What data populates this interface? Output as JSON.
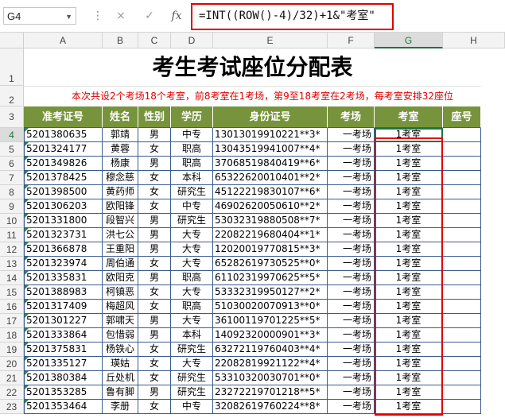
{
  "formula_bar": {
    "name_box": "G4",
    "cancel_icon": "×",
    "enter_icon": "✓",
    "fx_label": "fx",
    "formula": "=INT((ROW()-4)/32)+1&\"考室\""
  },
  "columns": [
    "A",
    "B",
    "C",
    "D",
    "E",
    "F",
    "G",
    "H"
  ],
  "selected_column": "G",
  "selected_row": "4",
  "rows_numbers": [
    "1",
    "2",
    "3",
    "4",
    "5",
    "6",
    "7",
    "8",
    "9",
    "10",
    "11",
    "12",
    "13",
    "14",
    "15",
    "16",
    "17",
    "18",
    "19",
    "20",
    "21",
    "22",
    "23"
  ],
  "sheet": {
    "title": "考生考试座位分配表",
    "subtitle": "本次共设2个考场18个考室，前8考室在1考场，第9至18考室在2考场，每考室安排32座位",
    "headers": [
      "准考证号",
      "姓名",
      "性别",
      "学历",
      "身份证号",
      "考场",
      "考室",
      "座号"
    ],
    "rows": [
      [
        "5201380635",
        "郭靖",
        "男",
        "中专",
        "13013019910221**3*",
        "一考场",
        "1考室",
        ""
      ],
      [
        "5201324177",
        "黄蓉",
        "女",
        "职高",
        "13043519941007**4*",
        "一考场",
        "1考室",
        ""
      ],
      [
        "5201349826",
        "杨康",
        "男",
        "职高",
        "37068519840419**6*",
        "一考场",
        "1考室",
        ""
      ],
      [
        "5201378425",
        "穆念慈",
        "女",
        "本科",
        "65322620010401**2*",
        "一考场",
        "1考室",
        ""
      ],
      [
        "5201398500",
        "黄药师",
        "女",
        "研究生",
        "45122219830107**6*",
        "一考场",
        "1考室",
        ""
      ],
      [
        "5201306203",
        "欧阳锋",
        "女",
        "中专",
        "46902620050610**2*",
        "一考场",
        "1考室",
        ""
      ],
      [
        "5201331800",
        "段智兴",
        "男",
        "研究生",
        "53032319880508**7*",
        "一考场",
        "1考室",
        ""
      ],
      [
        "5201323731",
        "洪七公",
        "男",
        "大专",
        "22082219680404**1*",
        "一考场",
        "1考室",
        ""
      ],
      [
        "5201366878",
        "王重阳",
        "男",
        "大专",
        "12020019770815**3*",
        "一考场",
        "1考室",
        ""
      ],
      [
        "5201323974",
        "周伯通",
        "女",
        "大专",
        "65282619730525**0*",
        "一考场",
        "1考室",
        ""
      ],
      [
        "5201335831",
        "欧阳克",
        "男",
        "职高",
        "61102319970625**5*",
        "一考场",
        "1考室",
        ""
      ],
      [
        "5201388983",
        "柯镇恶",
        "女",
        "大专",
        "53332319950127**2*",
        "一考场",
        "1考室",
        ""
      ],
      [
        "5201317409",
        "梅超风",
        "女",
        "职高",
        "51030020070913**0*",
        "一考场",
        "1考室",
        ""
      ],
      [
        "5201301227",
        "郭啸天",
        "男",
        "大专",
        "36100119701225**5*",
        "一考场",
        "1考室",
        ""
      ],
      [
        "5201333864",
        "包惜弱",
        "男",
        "本科",
        "14092320000901**3*",
        "一考场",
        "1考室",
        ""
      ],
      [
        "5201375831",
        "杨铁心",
        "女",
        "研究生",
        "63272119760403**4*",
        "一考场",
        "1考室",
        ""
      ],
      [
        "5201335127",
        "瑛姑",
        "女",
        "大专",
        "22082819921122**4*",
        "一考场",
        "1考室",
        ""
      ],
      [
        "5201380384",
        "丘处机",
        "女",
        "研究生",
        "53310320030701**0*",
        "一考场",
        "1考室",
        ""
      ],
      [
        "5201353285",
        "鲁有脚",
        "男",
        "研究生",
        "23272219701218**5*",
        "一考场",
        "1考室",
        ""
      ],
      [
        "5201353464",
        "李册",
        "女",
        "中专",
        "32082619760224**8*",
        "一考场",
        "1考室",
        ""
      ]
    ]
  },
  "colors": {
    "header_green": "#77933c",
    "accent_red": "#e00000",
    "selection_green": "#217346"
  }
}
